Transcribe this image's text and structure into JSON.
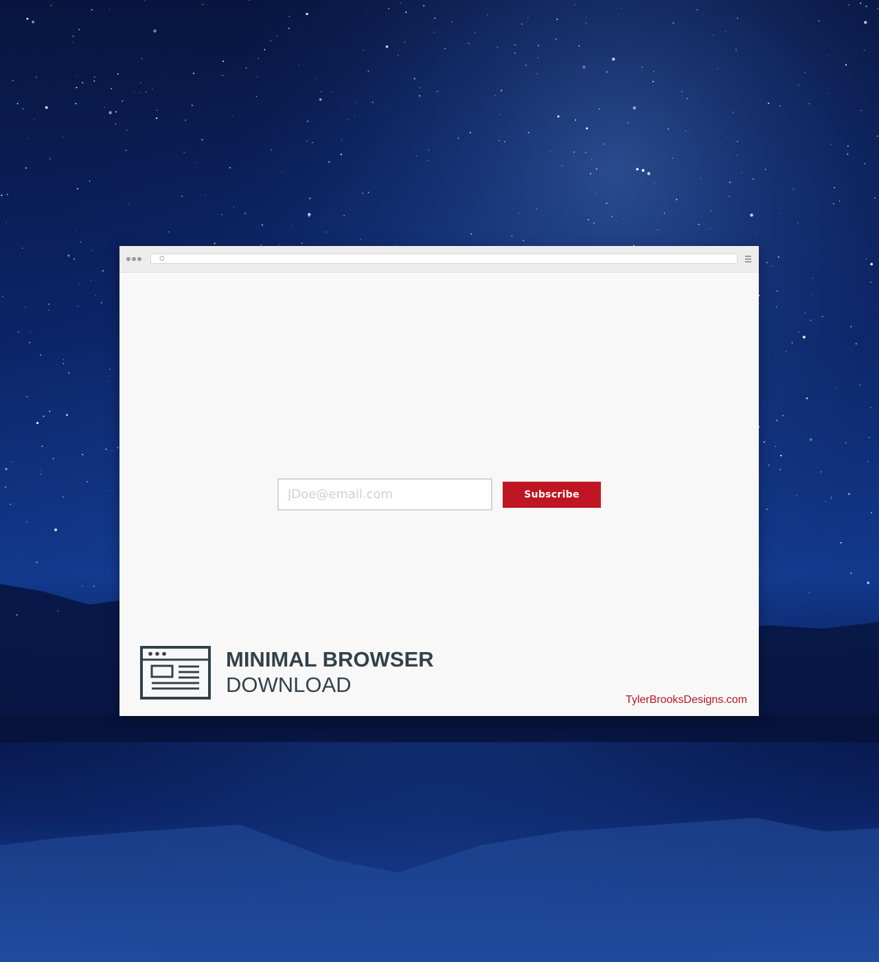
{
  "background": {
    "description_icon": "starry-night-lake-background",
    "sky_color": "#0b1e5c",
    "accent_glow": "#2a5fb8"
  },
  "browser": {
    "window_controls_icon": "three-dots-icon",
    "reload_icon": "reload-icon",
    "menu_icon": "hamburger-menu-icon",
    "address_value": ""
  },
  "form": {
    "email_placeholder": "JDoe@email.com",
    "email_value": "",
    "subscribe_label": "Subscribe",
    "button_color": "#c01522"
  },
  "branding": {
    "icon": "browser-window-icon",
    "title": "MINIMAL BROWSER",
    "subtitle": "DOWNLOAD",
    "text_color": "#334149"
  },
  "credit": {
    "text": "TylerBrooksDesigns.com",
    "color": "#b8141f"
  }
}
